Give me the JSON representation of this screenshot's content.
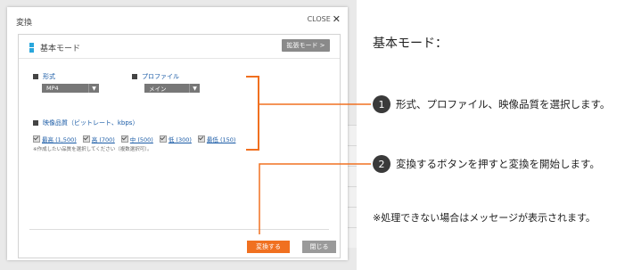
{
  "modal": {
    "title": "変換",
    "close_label": "CLOSE",
    "close_icon": "✕",
    "mode_title": "基本モード",
    "extended_button": "拡張モード >",
    "format": {
      "label": "形式",
      "value": "MP4"
    },
    "profile": {
      "label": "プロファイル",
      "value": "メイン"
    },
    "quality": {
      "label": "映像品質（ビットレート、kbps）",
      "options": [
        "最高 (1,500)",
        "高 (700)",
        "中 (500)",
        "低 (300)",
        "最低 (150)"
      ],
      "note": "※作成したい品質を選択してください（複数選択可）。"
    },
    "convert_button": "変換する",
    "close_button": "閉じる"
  },
  "annotations": {
    "headline": "基本モード：",
    "step1_number": "1",
    "step1_text": "形式、プロファイル、映像品質を選択します。",
    "step2_number": "2",
    "step2_text": "変換するボタンを押すと変換を開始します。",
    "note": "※処理できない場合はメッセージが表示されます。"
  },
  "colors": {
    "accent": "#f07020",
    "link": "#1a5ba6",
    "mode_icon": "#2aa7dc"
  }
}
